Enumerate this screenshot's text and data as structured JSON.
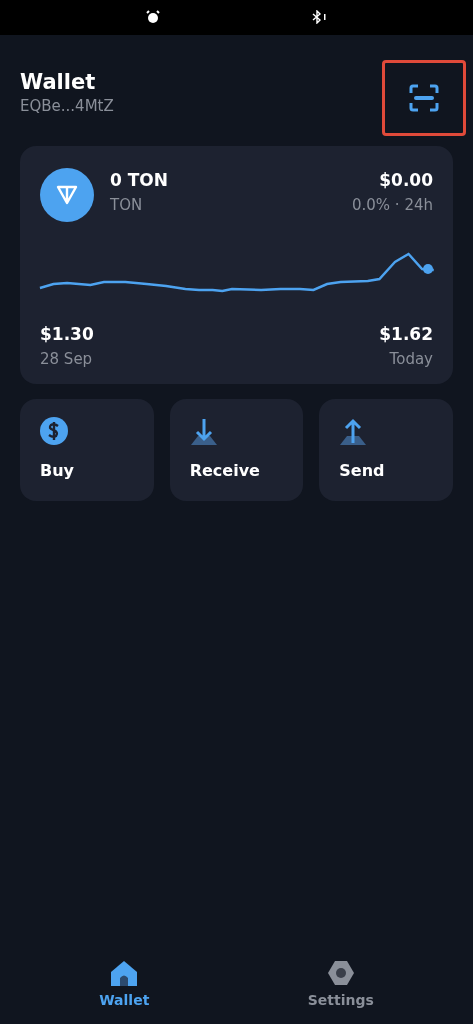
{
  "header": {
    "title": "Wallet",
    "address": "EQBe...4MtZ",
    "scan_button": {
      "highlighted": true
    }
  },
  "asset": {
    "amount": "0 TON",
    "symbol": "TON",
    "value": "$0.00",
    "change": "0.0% · 24h",
    "start_price": "$1.30",
    "start_label": "28 Sep",
    "end_price": "$1.62",
    "end_label": "Today"
  },
  "actions": [
    {
      "kind": "buy",
      "label": "Buy"
    },
    {
      "kind": "receive",
      "label": "Receive"
    },
    {
      "kind": "send",
      "label": "Send"
    }
  ],
  "tabs": [
    {
      "kind": "wallet",
      "label": "Wallet",
      "selected": true
    },
    {
      "kind": "settings",
      "label": "Settings",
      "selected": false
    }
  ]
}
